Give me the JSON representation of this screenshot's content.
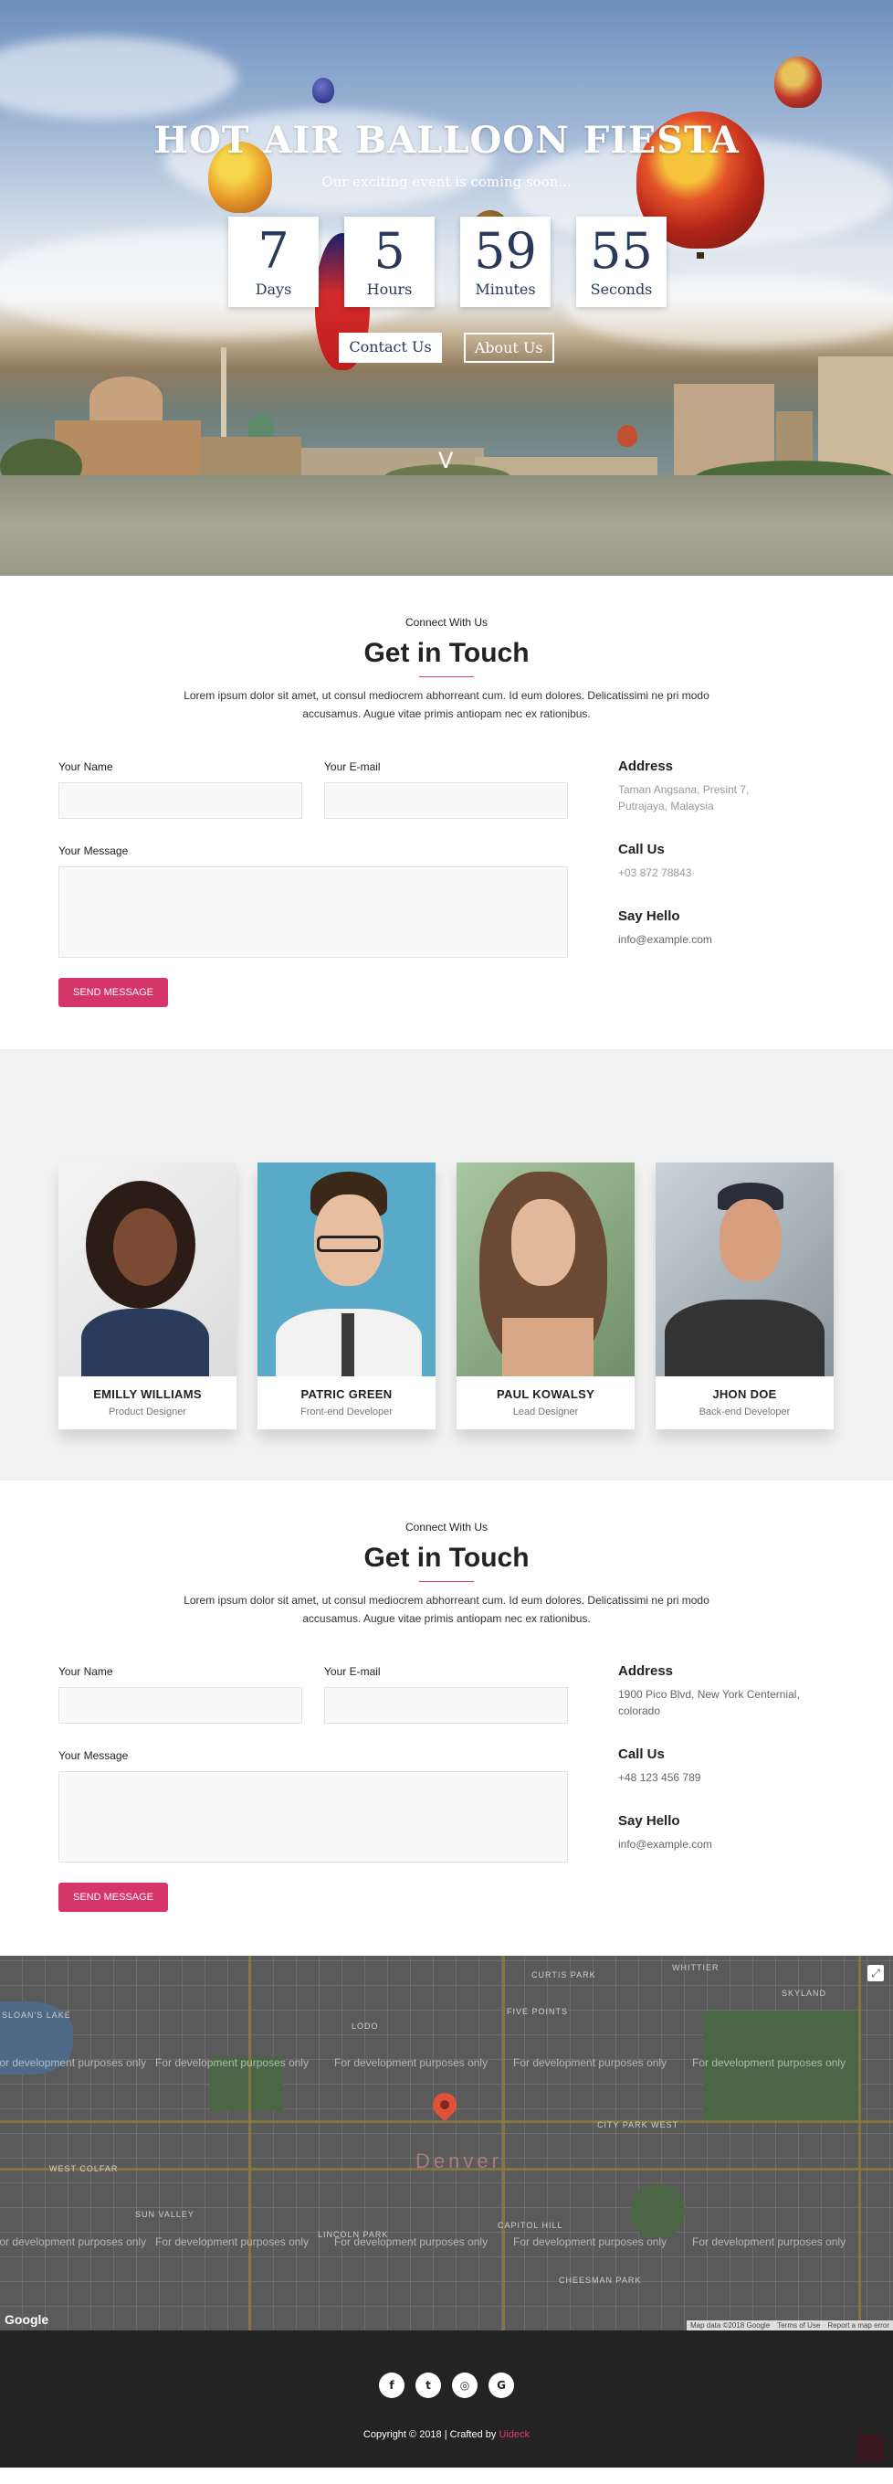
{
  "hero": {
    "title": "HOT AIR BALLOON FIESTA",
    "subtitle": "Our exciting event is coming soon...",
    "countdown": [
      {
        "value": "7",
        "label": "Days"
      },
      {
        "value": "5",
        "label": "Hours"
      },
      {
        "value": "59",
        "label": "Minutes"
      },
      {
        "value": "55",
        "label": "Seconds"
      }
    ],
    "contact_btn": "Contact Us",
    "about_btn": "About Us",
    "scroll_glyph": "V"
  },
  "contact1": {
    "eyebrow": "Connect With Us",
    "title": "Get in Touch",
    "text": "Lorem ipsum dolor sit amet, ut consul mediocrem abhorreant cum. Id eum dolores. Delicatissimi ne pri modo accusamus. Augue vitae primis antiopam nec ex rationibus.",
    "name_label": "Your Name",
    "email_label": "Your E-mail",
    "message_label": "Your Message",
    "send_label": "SEND MESSAGE",
    "address_title": "Address",
    "address": "Taman Angsana, Presint 7, Putrajaya, Malaysia",
    "call_title": "Call Us",
    "phone": "+03 872 78843",
    "hello_title": "Say Hello",
    "email": "info@example.com"
  },
  "team": [
    {
      "name": "EMILLY WILLIAMS",
      "role": "Product Designer"
    },
    {
      "name": "PATRIC GREEN",
      "role": "Front-end Developer"
    },
    {
      "name": "PAUL KOWALSY",
      "role": "Lead Designer"
    },
    {
      "name": "JHON DOE",
      "role": "Back-end Developer"
    }
  ],
  "contact2": {
    "eyebrow": "Connect With Us",
    "title": "Get in Touch",
    "text": "Lorem ipsum dolor sit amet, ut consul mediocrem abhorreant cum. Id eum dolores. Delicatissimi ne pri modo accusamus. Augue vitae primis antiopam nec ex rationibus.",
    "name_label": "Your Name",
    "email_label": "Your E-mail",
    "message_label": "Your Message",
    "send_label": "SEND MESSAGE",
    "address_title": "Address",
    "address": "1900 Pico Blvd, New York Centernial, colorado",
    "call_title": "Call Us",
    "phone": "+48 123 456 789",
    "hello_title": "Say Hello",
    "email": "info@example.com"
  },
  "map": {
    "watermark": "For development purposes only",
    "city": "Denver",
    "google": "Google",
    "attribution": [
      "Map data ©2018 Google",
      "Terms of Use",
      "Report a map error"
    ],
    "places": [
      "WHITTIER",
      "CURTIS PARK",
      "SKYLAND",
      "FIVE POINTS",
      "LODO",
      "CITY PARK WEST",
      "WEST COLFAR",
      "SUN VALLEY",
      "LINCOLN PARK",
      "CAPITOL HILL",
      "CHEESMAN PARK",
      "SLOAN'S LAKE"
    ]
  },
  "footer": {
    "copyright": "Copyright © 2018 | Crafted by ",
    "brand": "Uideck",
    "socials": [
      "f",
      "t",
      "◎",
      "G"
    ]
  },
  "colors": {
    "accent": "#d6356a",
    "hero_text": "#273a5c",
    "footer_bg": "#232323"
  }
}
